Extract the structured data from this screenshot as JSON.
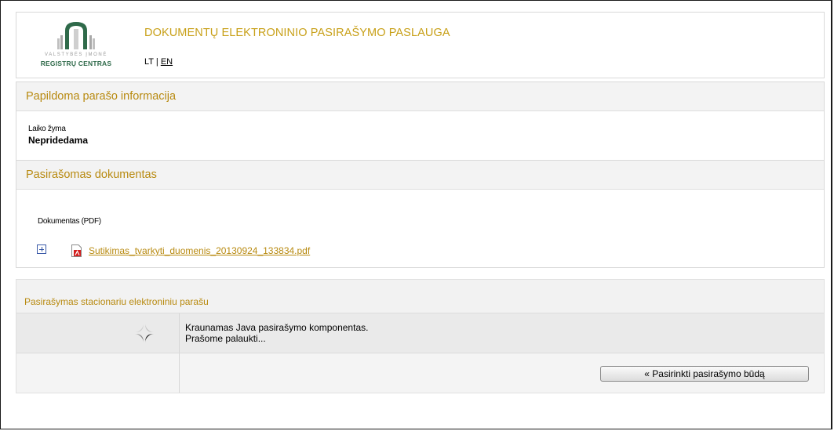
{
  "header": {
    "logo": {
      "small_text": "VALSTYBĖS ĮMONĖ",
      "main_text": "REGISTRŲ CENTRAS"
    },
    "title": "DOKUMENTŲ ELEKTRONINIO PASIRAŠYMO PASLAUGA",
    "lang_lt": "LT",
    "lang_sep": "|",
    "lang_en": "EN"
  },
  "signature_info": {
    "heading": "Papildoma parašo informacija",
    "timestamp_label": "Laiko žyma",
    "timestamp_value": "Nepridedama"
  },
  "document": {
    "heading": "Pasirašomas dokumentas",
    "doc_label": "Dokumentas (PDF)",
    "file_name": "Sutikimas_tvarkyti_duomenis_20130924_133834.pdf"
  },
  "signing": {
    "heading": "Pasirašymas stacionariu elektroniniu parašu",
    "loading_line1": "Kraunamas Java pasirašymo komponentas.",
    "loading_line2": "Prašome palaukti...",
    "choose_method_button": "« Pasirinkti pasirašymo būdą"
  },
  "colors": {
    "accent": "#b88a10",
    "logo_green": "#2f6a4a",
    "pdf_red": "#d42020",
    "link_blue": "#2b4ea0"
  },
  "icons": [
    "registru-centras-logo",
    "expand-icon",
    "pdf-icon",
    "loading-spinner-icon"
  ]
}
